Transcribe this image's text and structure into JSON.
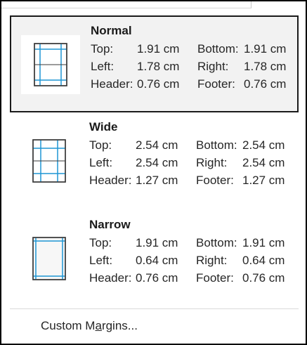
{
  "options": [
    {
      "title": "Normal",
      "icon": "normal-margins-icon",
      "top_label": "Top:",
      "top": "1.91 cm",
      "bottom_label": "Bottom:",
      "bottom": "1.91 cm",
      "left_label": "Left:",
      "left": "1.78 cm",
      "right_label": "Right:",
      "right": "1.78 cm",
      "header_label": "Header:",
      "header": "0.76 cm",
      "footer_label": "Footer:",
      "footer": "0.76 cm"
    },
    {
      "title": "Wide",
      "icon": "wide-margins-icon",
      "top_label": "Top:",
      "top": "2.54 cm",
      "bottom_label": "Bottom:",
      "bottom": "2.54 cm",
      "left_label": "Left:",
      "left": "2.54 cm",
      "right_label": "Right:",
      "right": "2.54 cm",
      "header_label": "Header:",
      "header": "1.27 cm",
      "footer_label": "Footer:",
      "footer": "1.27 cm"
    },
    {
      "title": "Narrow",
      "icon": "narrow-margins-icon",
      "top_label": "Top:",
      "top": "1.91 cm",
      "bottom_label": "Bottom:",
      "bottom": "1.91 cm",
      "left_label": "Left:",
      "left": "0.64 cm",
      "right_label": "Right:",
      "right": "0.64 cm",
      "header_label": "Header:",
      "header": "0.76 cm",
      "footer_label": "Footer:",
      "footer": "0.76 cm"
    }
  ],
  "custom_margins": {
    "label_before": "Custom M",
    "label_underlined": "a",
    "label_after": "rgins..."
  },
  "colors": {
    "accent": "#1e96d4",
    "selected_bg": "#f2f2f2",
    "selected_border": "#1a1a1a"
  }
}
